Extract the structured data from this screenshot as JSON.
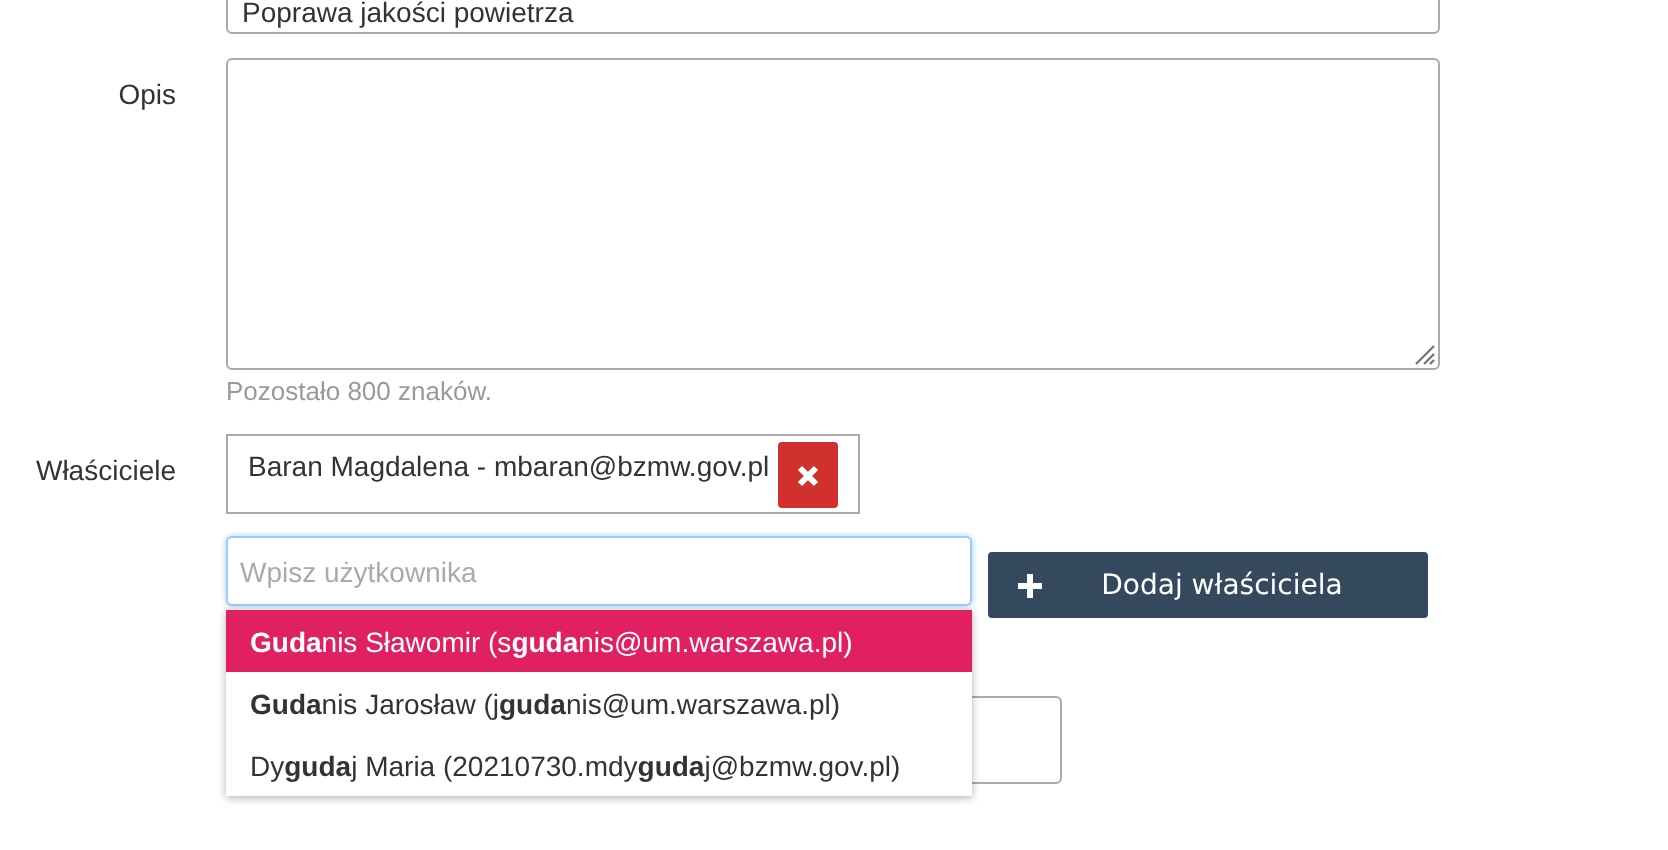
{
  "title_field": {
    "value": "Poprawa jakości powietrza"
  },
  "description": {
    "label": "Opis",
    "hint": "Pozostało 800 znaków."
  },
  "owners": {
    "label": "Właściciele",
    "items": [
      {
        "text": "Baran Magdalena - mbaran@bzmw.gov.pl"
      }
    ],
    "search": {
      "placeholder": "Wpisz użytkownika"
    },
    "add_button": "Dodaj właściciela",
    "suggestions": [
      {
        "text": "**Guda**nis Sławomir (s**guda**nis@um.warszawa.pl)",
        "selected": true
      },
      {
        "text": "**Guda**nis Jarosław (j**guda**nis@um.warszawa.pl)",
        "selected": false
      },
      {
        "text": "Dy**guda**j Maria (20210730.mdy**guda**j@bzmw.gov.pl)",
        "selected": false
      }
    ]
  }
}
